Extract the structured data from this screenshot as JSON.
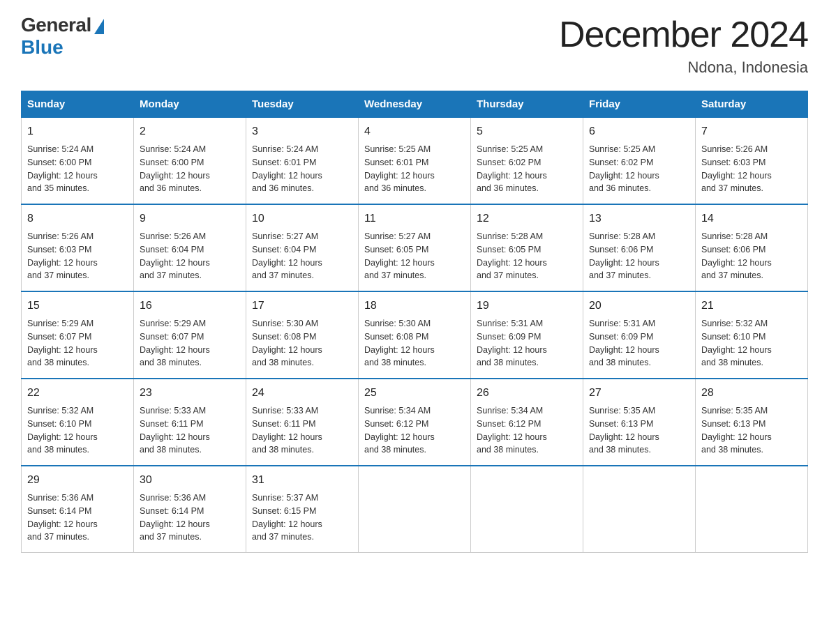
{
  "header": {
    "title": "December 2024",
    "subtitle": "Ndona, Indonesia",
    "logo_text_general": "General",
    "logo_text_blue": "Blue"
  },
  "weekdays": [
    "Sunday",
    "Monday",
    "Tuesday",
    "Wednesday",
    "Thursday",
    "Friday",
    "Saturday"
  ],
  "rows": [
    [
      {
        "day": "1",
        "sunrise": "5:24 AM",
        "sunset": "6:00 PM",
        "daylight": "12 hours and 35 minutes."
      },
      {
        "day": "2",
        "sunrise": "5:24 AM",
        "sunset": "6:00 PM",
        "daylight": "12 hours and 36 minutes."
      },
      {
        "day": "3",
        "sunrise": "5:24 AM",
        "sunset": "6:01 PM",
        "daylight": "12 hours and 36 minutes."
      },
      {
        "day": "4",
        "sunrise": "5:25 AM",
        "sunset": "6:01 PM",
        "daylight": "12 hours and 36 minutes."
      },
      {
        "day": "5",
        "sunrise": "5:25 AM",
        "sunset": "6:02 PM",
        "daylight": "12 hours and 36 minutes."
      },
      {
        "day": "6",
        "sunrise": "5:25 AM",
        "sunset": "6:02 PM",
        "daylight": "12 hours and 36 minutes."
      },
      {
        "day": "7",
        "sunrise": "5:26 AM",
        "sunset": "6:03 PM",
        "daylight": "12 hours and 37 minutes."
      }
    ],
    [
      {
        "day": "8",
        "sunrise": "5:26 AM",
        "sunset": "6:03 PM",
        "daylight": "12 hours and 37 minutes."
      },
      {
        "day": "9",
        "sunrise": "5:26 AM",
        "sunset": "6:04 PM",
        "daylight": "12 hours and 37 minutes."
      },
      {
        "day": "10",
        "sunrise": "5:27 AM",
        "sunset": "6:04 PM",
        "daylight": "12 hours and 37 minutes."
      },
      {
        "day": "11",
        "sunrise": "5:27 AM",
        "sunset": "6:05 PM",
        "daylight": "12 hours and 37 minutes."
      },
      {
        "day": "12",
        "sunrise": "5:28 AM",
        "sunset": "6:05 PM",
        "daylight": "12 hours and 37 minutes."
      },
      {
        "day": "13",
        "sunrise": "5:28 AM",
        "sunset": "6:06 PM",
        "daylight": "12 hours and 37 minutes."
      },
      {
        "day": "14",
        "sunrise": "5:28 AM",
        "sunset": "6:06 PM",
        "daylight": "12 hours and 37 minutes."
      }
    ],
    [
      {
        "day": "15",
        "sunrise": "5:29 AM",
        "sunset": "6:07 PM",
        "daylight": "12 hours and 38 minutes."
      },
      {
        "day": "16",
        "sunrise": "5:29 AM",
        "sunset": "6:07 PM",
        "daylight": "12 hours and 38 minutes."
      },
      {
        "day": "17",
        "sunrise": "5:30 AM",
        "sunset": "6:08 PM",
        "daylight": "12 hours and 38 minutes."
      },
      {
        "day": "18",
        "sunrise": "5:30 AM",
        "sunset": "6:08 PM",
        "daylight": "12 hours and 38 minutes."
      },
      {
        "day": "19",
        "sunrise": "5:31 AM",
        "sunset": "6:09 PM",
        "daylight": "12 hours and 38 minutes."
      },
      {
        "day": "20",
        "sunrise": "5:31 AM",
        "sunset": "6:09 PM",
        "daylight": "12 hours and 38 minutes."
      },
      {
        "day": "21",
        "sunrise": "5:32 AM",
        "sunset": "6:10 PM",
        "daylight": "12 hours and 38 minutes."
      }
    ],
    [
      {
        "day": "22",
        "sunrise": "5:32 AM",
        "sunset": "6:10 PM",
        "daylight": "12 hours and 38 minutes."
      },
      {
        "day": "23",
        "sunrise": "5:33 AM",
        "sunset": "6:11 PM",
        "daylight": "12 hours and 38 minutes."
      },
      {
        "day": "24",
        "sunrise": "5:33 AM",
        "sunset": "6:11 PM",
        "daylight": "12 hours and 38 minutes."
      },
      {
        "day": "25",
        "sunrise": "5:34 AM",
        "sunset": "6:12 PM",
        "daylight": "12 hours and 38 minutes."
      },
      {
        "day": "26",
        "sunrise": "5:34 AM",
        "sunset": "6:12 PM",
        "daylight": "12 hours and 38 minutes."
      },
      {
        "day": "27",
        "sunrise": "5:35 AM",
        "sunset": "6:13 PM",
        "daylight": "12 hours and 38 minutes."
      },
      {
        "day": "28",
        "sunrise": "5:35 AM",
        "sunset": "6:13 PM",
        "daylight": "12 hours and 38 minutes."
      }
    ],
    [
      {
        "day": "29",
        "sunrise": "5:36 AM",
        "sunset": "6:14 PM",
        "daylight": "12 hours and 37 minutes."
      },
      {
        "day": "30",
        "sunrise": "5:36 AM",
        "sunset": "6:14 PM",
        "daylight": "12 hours and 37 minutes."
      },
      {
        "day": "31",
        "sunrise": "5:37 AM",
        "sunset": "6:15 PM",
        "daylight": "12 hours and 37 minutes."
      },
      null,
      null,
      null,
      null
    ]
  ],
  "labels": {
    "sunrise": "Sunrise:",
    "sunset": "Sunset:",
    "daylight": "Daylight:"
  }
}
